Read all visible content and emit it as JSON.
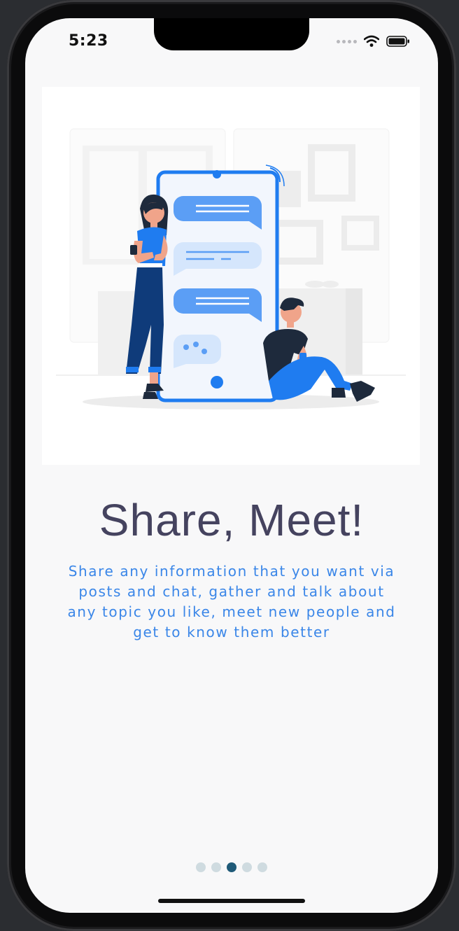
{
  "status_bar": {
    "time": "5:23"
  },
  "onboarding": {
    "title": "Share, Meet!",
    "description": "Share any information that you want via posts and chat, gather and talk about any topic you like, meet new people and get to know them better",
    "pages": 5,
    "current_page": 3
  },
  "icons": {
    "signal": "cellular-signal-icon",
    "wifi": "wifi-icon",
    "battery": "battery-icon"
  },
  "colors": {
    "accent": "#1f7cf0",
    "title": "#45435f",
    "description": "#3a86e8",
    "page_dot_active": "#1f5a78",
    "page_dot_inactive": "#cfdbe0"
  }
}
